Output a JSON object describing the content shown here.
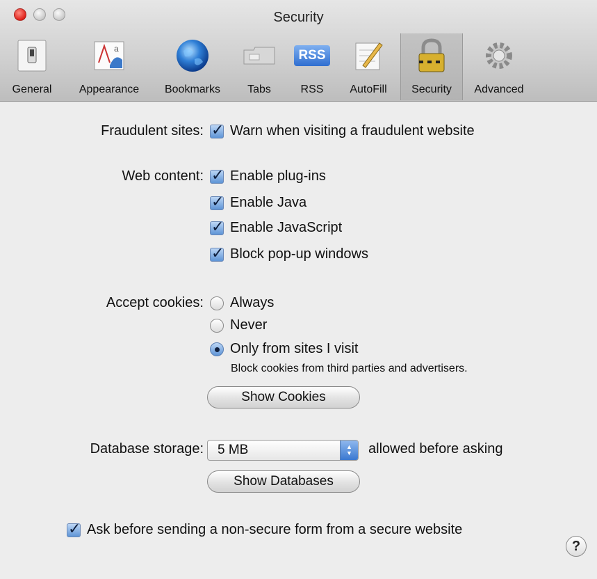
{
  "window": {
    "title": "Security"
  },
  "toolbar": {
    "items": [
      {
        "label": "General",
        "icon": "general-switch-icon",
        "selected": false
      },
      {
        "label": "Appearance",
        "icon": "appearance-icon",
        "selected": false
      },
      {
        "label": "Bookmarks",
        "icon": "globe-icon",
        "selected": false
      },
      {
        "label": "Tabs",
        "icon": "tabs-icon",
        "selected": false
      },
      {
        "label": "RSS",
        "icon": "rss-icon",
        "selected": false,
        "icon_text": "RSS"
      },
      {
        "label": "AutoFill",
        "icon": "autofill-pencil-icon",
        "selected": false
      },
      {
        "label": "Security",
        "icon": "lock-icon",
        "selected": true
      },
      {
        "label": "Advanced",
        "icon": "gear-icon",
        "selected": false
      }
    ]
  },
  "fraud": {
    "label": "Fraudulent sites:",
    "option": "Warn when visiting a fraudulent website",
    "checked": true
  },
  "web_content": {
    "label": "Web content:",
    "options": [
      {
        "text": "Enable plug-ins",
        "checked": true
      },
      {
        "text": "Enable Java",
        "checked": true
      },
      {
        "text": "Enable JavaScript",
        "checked": true
      },
      {
        "text": "Block pop-up windows",
        "checked": true
      }
    ]
  },
  "cookies": {
    "label": "Accept cookies:",
    "options": [
      {
        "text": "Always",
        "selected": false
      },
      {
        "text": "Never",
        "selected": false
      },
      {
        "text": "Only from sites I visit",
        "selected": true
      }
    ],
    "note": "Block cookies from third parties and advertisers.",
    "show_button": "Show Cookies"
  },
  "database": {
    "label": "Database storage:",
    "value": "5 MB",
    "suffix": "allowed before asking",
    "show_button": "Show Databases"
  },
  "nonsecure": {
    "text": "Ask before sending a non-secure form from a secure website",
    "checked": true
  },
  "help": {
    "label": "?"
  },
  "colors": {
    "accent": "#5e94d6",
    "close_button": "#e0221b"
  }
}
